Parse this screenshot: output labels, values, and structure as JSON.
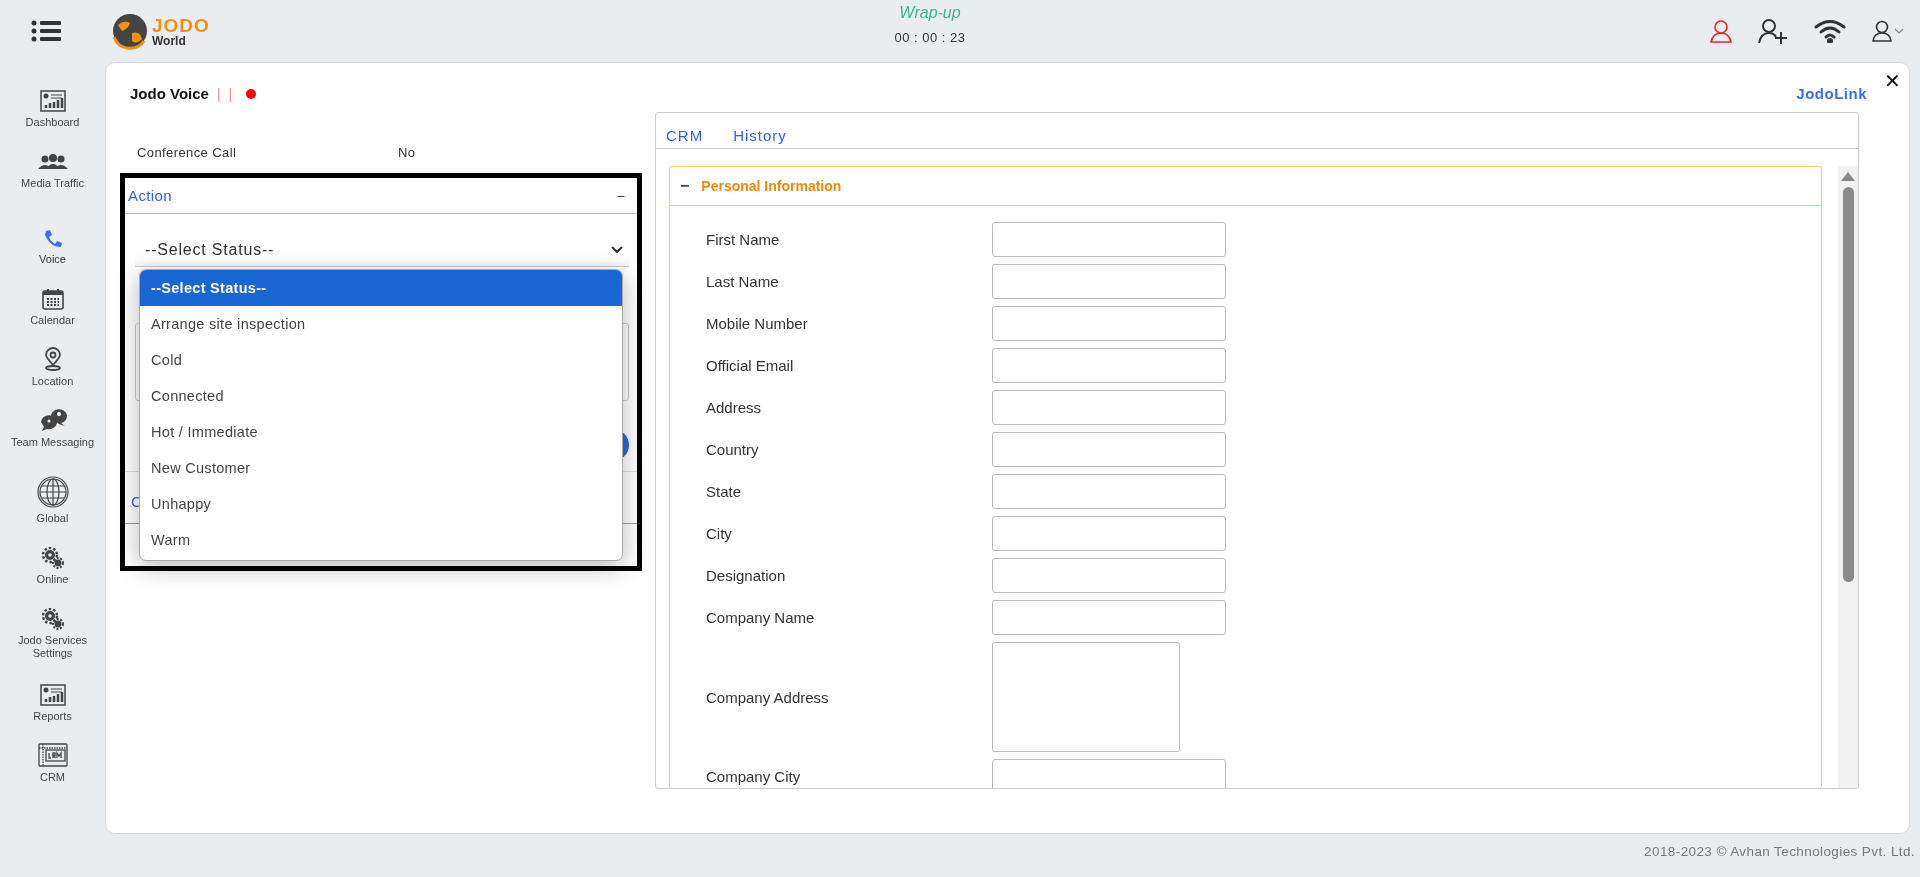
{
  "header": {
    "call_state": "Wrap-up",
    "timer": "00 : 00 : 23",
    "logo": {
      "brand": "JODO",
      "sub": "World"
    }
  },
  "sidebar": {
    "items": [
      {
        "label": "Dashboard",
        "selected": false
      },
      {
        "label": "Media Traffic",
        "selected": false
      },
      {
        "label": "Voice",
        "selected": true
      },
      {
        "label": "Calendar",
        "selected": false
      },
      {
        "label": "Location",
        "selected": false
      },
      {
        "label": "Team Messaging",
        "selected": false
      },
      {
        "label": "Global",
        "selected": false
      },
      {
        "label": "Online",
        "selected": false
      },
      {
        "label": "Jodo Services Settings",
        "selected": false
      },
      {
        "label": "Reports",
        "selected": false
      },
      {
        "label": "CRM",
        "selected": false
      }
    ]
  },
  "panel": {
    "title": "Jodo Voice",
    "separators": [
      "|",
      "|"
    ],
    "link": "JodoLink",
    "close": "✕",
    "conference": {
      "label": "Conference Call",
      "value": "No"
    },
    "action": {
      "title": "Action",
      "toggle": "−",
      "select": "--Select Status--",
      "section_label": "C",
      "options": [
        {
          "label": "--Select Status--",
          "selected": true
        },
        {
          "label": "Arrange site inspection",
          "selected": false
        },
        {
          "label": "Cold",
          "selected": false
        },
        {
          "label": "Connected",
          "selected": false
        },
        {
          "label": "Hot / Immediate",
          "selected": false
        },
        {
          "label": "New Customer",
          "selected": false
        },
        {
          "label": "Unhappy",
          "selected": false
        },
        {
          "label": "Warm",
          "selected": false
        }
      ]
    }
  },
  "crm": {
    "tabs": [
      {
        "label": "CRM"
      },
      {
        "label": "History"
      }
    ],
    "section": {
      "title": "Personal Information",
      "toggle": "−",
      "fields": [
        {
          "label": "First Name",
          "kind": "input"
        },
        {
          "label": "Last Name",
          "kind": "input"
        },
        {
          "label": "Mobile Number",
          "kind": "input"
        },
        {
          "label": "Official Email",
          "kind": "input"
        },
        {
          "label": "Address",
          "kind": "input"
        },
        {
          "label": "Country",
          "kind": "input"
        },
        {
          "label": "State",
          "kind": "input"
        },
        {
          "label": "City",
          "kind": "input"
        },
        {
          "label": "Designation",
          "kind": "input"
        },
        {
          "label": "Company Name",
          "kind": "input"
        },
        {
          "label": "Company Address",
          "kind": "textarea"
        },
        {
          "label": "Company City",
          "kind": "input"
        }
      ]
    }
  },
  "footer": "2018-2023 © Avhan Technologies Pvt. Ltd."
}
